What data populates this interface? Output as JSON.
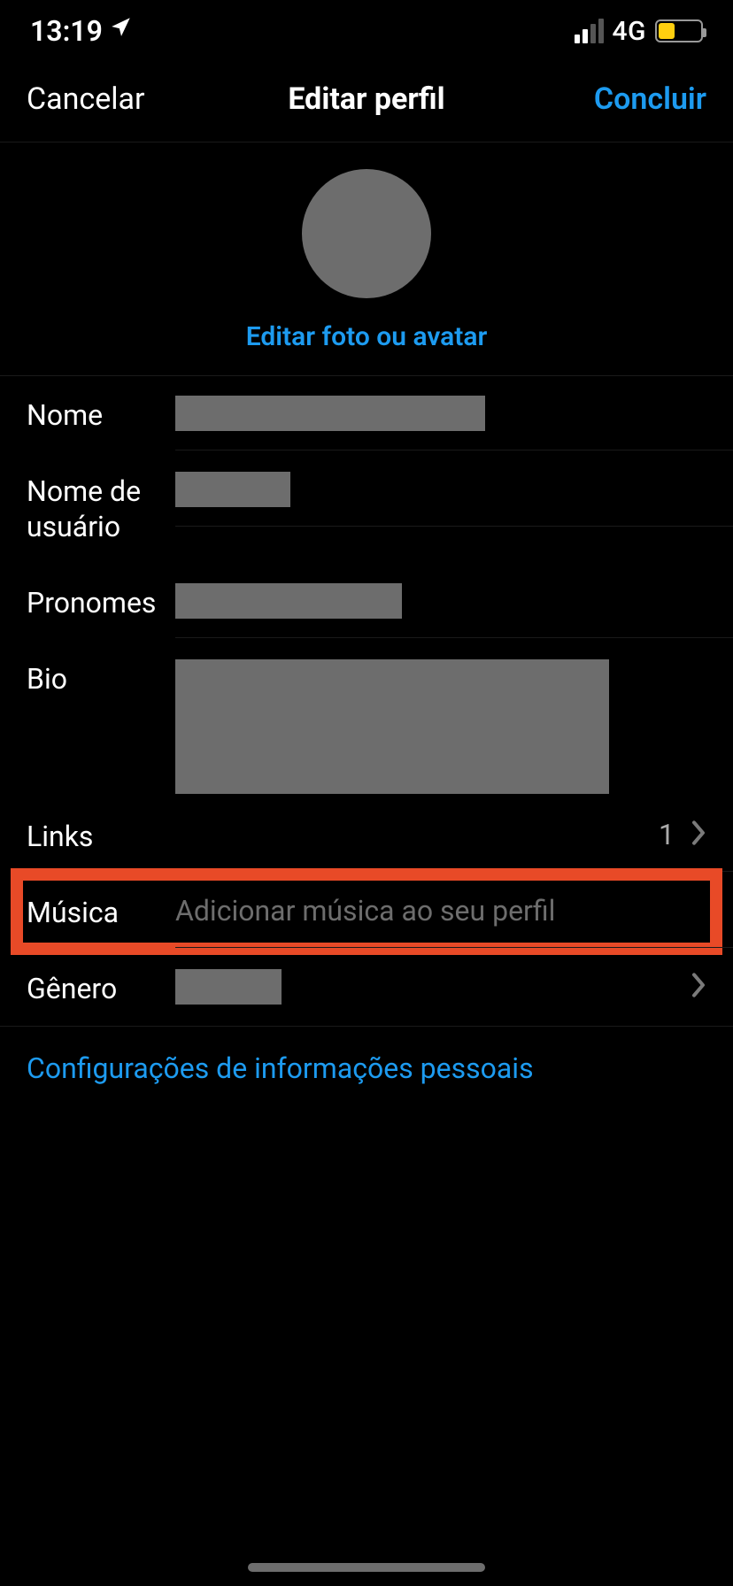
{
  "status": {
    "time": "13:19",
    "network_label": "4G"
  },
  "nav": {
    "cancel": "Cancelar",
    "title": "Editar perfil",
    "done": "Concluir"
  },
  "avatar": {
    "edit_label": "Editar foto ou avatar"
  },
  "fields": {
    "name_label": "Nome",
    "username_label": "Nome de usuário",
    "pronouns_label": "Pronomes",
    "bio_label": "Bio",
    "links_label": "Links",
    "links_count": "1",
    "music_label": "Música",
    "music_placeholder": "Adicionar música ao seu perfil",
    "gender_label": "Gênero"
  },
  "personal_info_link": "Configurações de informações pessoais"
}
